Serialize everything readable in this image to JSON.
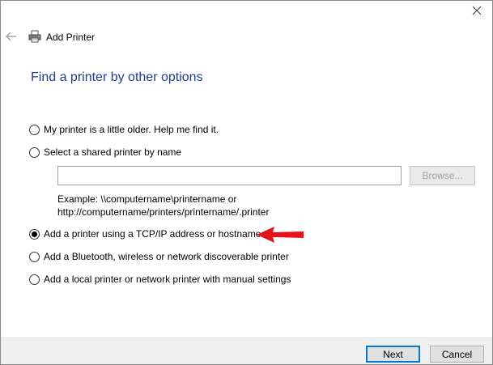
{
  "window": {
    "title": "Add Printer"
  },
  "page": {
    "heading": "Find a printer by other options"
  },
  "options": [
    {
      "label": "My printer is a little older. Help me find it.",
      "checked": false
    },
    {
      "label": "Select a shared printer by name",
      "checked": false
    },
    {
      "label": "Add a printer using a TCP/IP address or hostname",
      "checked": true
    },
    {
      "label": "Add a Bluetooth, wireless or network discoverable printer",
      "checked": false
    },
    {
      "label": "Add a local printer or network printer with manual settings",
      "checked": false
    }
  ],
  "shared": {
    "value": "",
    "browse_label": "Browse...",
    "example_line1": "Example: \\\\computername\\printername or",
    "example_line2": "http://computername/printers/printername/.printer"
  },
  "footer": {
    "next_label": "Next",
    "cancel_label": "Cancel"
  },
  "colors": {
    "heading": "#1e3f8f",
    "annotation_arrow": "#e8121c",
    "default_button_border": "#0078d7"
  },
  "icons": {
    "close": "close-icon",
    "back": "back-arrow-icon",
    "printer": "printer-icon",
    "annotation": "red-arrow-icon"
  }
}
